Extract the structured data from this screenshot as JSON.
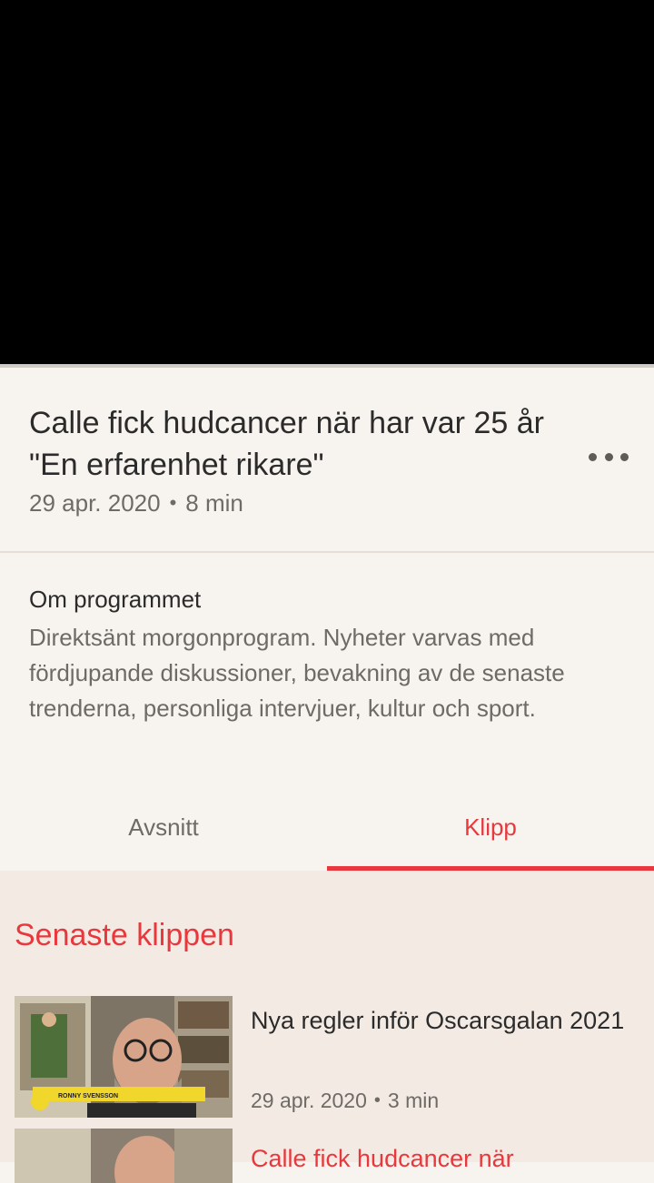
{
  "player": {
    "state": "black"
  },
  "episode": {
    "title": "Calle fick hudcancer när har var 25 år \"En erfarenhet rikare\"",
    "date": "29 apr. 2020",
    "duration": "8 min",
    "separator": "•"
  },
  "about": {
    "heading": "Om programmet",
    "description": "Direktsänt morgonprogram. Nyheter varvas med fördjupande diskussioner, bevakning av de senaste trenderna, personliga intervjuer, kultur och sport."
  },
  "tabs": [
    {
      "label": "Avsnitt",
      "selected": false
    },
    {
      "label": "Klipp",
      "selected": true
    }
  ],
  "clips_section": {
    "title": "Senaste klippen",
    "items": [
      {
        "title": "Nya regler inför Oscarsgalan 2021",
        "date": "29 apr. 2020",
        "duration": "3 min",
        "lower_third_name": "RONNY SVENSSON"
      },
      {
        "title": "Calle fick hudcancer när"
      }
    ]
  },
  "colors": {
    "accent": "#e8383d",
    "background": "#f7f3ee",
    "content_background": "#f3ebe3"
  }
}
